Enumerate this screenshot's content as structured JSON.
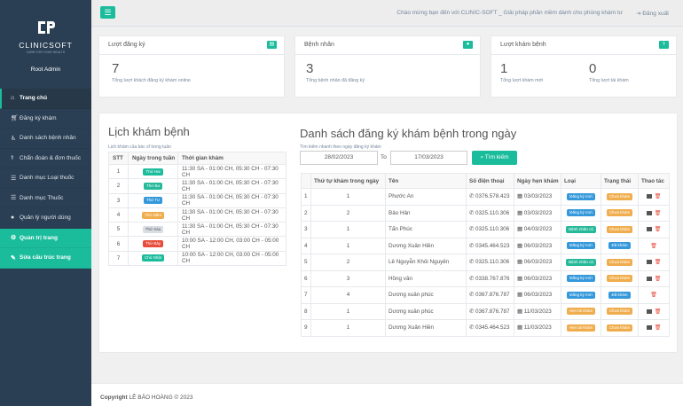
{
  "sidebar": {
    "logo_text": "CLINICSOFT",
    "logo_tagline": "CARE FOR YOUR HEALTH",
    "user": "Root Admin",
    "items": [
      {
        "label": "Trang chủ",
        "icon": "home-icon"
      },
      {
        "label": "Đăng ký khám",
        "icon": "cart-icon"
      },
      {
        "label": "Danh sách bệnh nhân",
        "icon": "wheelchair-icon"
      },
      {
        "label": "Chẩn đoán & đơn thuốc",
        "icon": "stethoscope-icon"
      },
      {
        "label": "Danh mục Loại thuốc",
        "icon": "list-icon"
      },
      {
        "label": "Danh mục Thuốc",
        "icon": "list-icon"
      },
      {
        "label": "Quản lý người dùng",
        "icon": "user-icon"
      },
      {
        "label": "Quản trị trang",
        "icon": "gear-icon"
      },
      {
        "label": "Sửa cấu trúc trang",
        "icon": "pencil-icon"
      }
    ]
  },
  "topbar": {
    "welcome": "Chào mừng bạn đến với CLINIC-SOFT _ Giải pháp phần mềm dành cho phòng khám tư",
    "logout": "Đăng xuất"
  },
  "stats": {
    "registrations": {
      "title": "Lượt đăng ký",
      "value": "7",
      "caption": "Tổng lượt khách đăng ký khám online"
    },
    "patients": {
      "title": "Bệnh nhân",
      "value": "3",
      "caption": "Tổng bệnh nhân đã đăng ký"
    },
    "visits": {
      "title": "Lượt khám bệnh",
      "new_value": "1",
      "new_caption": "Tổng lượt khám mới",
      "re_value": "0",
      "re_caption": "Tổng lượt tái khám"
    }
  },
  "schedule": {
    "title": "Lịch khám bệnh",
    "subtitle": "Lịch khám của bác sĩ trong tuần",
    "headers": [
      "STT",
      "Ngày trong tuần",
      "Thời gian khám"
    ],
    "rows": [
      {
        "stt": "1",
        "day": "Thứ Hai",
        "color": "#1abc9c",
        "time": "11:30 SA - 01:00 CH, 05:30 CH - 07:30 CH"
      },
      {
        "stt": "2",
        "day": "Thứ Ba",
        "color": "#26b99a",
        "time": "11:30 SA - 01:00 CH, 05:30 CH - 07:30 CH"
      },
      {
        "stt": "3",
        "day": "Thứ Tư",
        "color": "#3498db",
        "time": "11:30 SA - 01:00 CH, 05:30 CH - 07:30 CH"
      },
      {
        "stt": "4",
        "day": "Thứ Năm",
        "color": "#f0ad4e",
        "time": "11:30 SA - 01:00 CH, 05:30 CH - 07:30 CH"
      },
      {
        "stt": "5",
        "day": "Thứ Sáu",
        "color": "#d9dee4",
        "time": "11:30 SA - 01:00 CH, 05:30 CH - 07:30 CH"
      },
      {
        "stt": "6",
        "day": "Thứ Bảy",
        "color": "#e74c3c",
        "time": "10:00 SA - 12:00 CH, 03:00 CH - 05:00 CH"
      },
      {
        "stt": "7",
        "day": "Chủ Nhật",
        "color": "#1abc9c",
        "time": "10:00 SA - 12:00 CH, 03:00 CH - 05:00 CH"
      }
    ]
  },
  "registrations": {
    "title": "Danh sách đăng ký khám bệnh trong ngày",
    "search_label": "Tìm kiếm nhanh theo ngày đăng ký khám",
    "date_from": "28/02/2023",
    "to_label": "To",
    "date_to": "17/03/2023",
    "search_button": "Tìm kiếm",
    "headers": [
      "",
      "Thứ tự khám trong ngày",
      "Tên",
      "Số điện thoại",
      "Ngày hẹn khám",
      "Loại",
      "Trạng thái",
      "Thao tác"
    ],
    "rows": [
      {
        "idx": "1",
        "order": "1",
        "name": "Phước An",
        "phone": "0376.578.423",
        "date": "03/03/2023",
        "type": "Đăng ký mới",
        "type_color": "#3498db",
        "status": "Chưa khám",
        "status_color": "#f0ad4e",
        "view": true
      },
      {
        "idx": "2",
        "order": "2",
        "name": "Bảo Hân",
        "phone": "0325.110.306",
        "date": "03/03/2023",
        "type": "Đăng ký mới",
        "type_color": "#3498db",
        "status": "Chưa khám",
        "status_color": "#f0ad4e",
        "view": true
      },
      {
        "idx": "3",
        "order": "1",
        "name": "Tấn Phúc",
        "phone": "0325.110.306",
        "date": "04/03/2023",
        "type": "Bệnh nhân cũ",
        "type_color": "#26b99a",
        "status": "Chưa khám",
        "status_color": "#f0ad4e",
        "view": true
      },
      {
        "idx": "4",
        "order": "1",
        "name": "Dương Xuân Hiền",
        "phone": "0345.464.523",
        "date": "06/03/2023",
        "type": "Đăng ký mới",
        "type_color": "#3498db",
        "status": "Đã khám",
        "status_color": "#3498db",
        "view": false
      },
      {
        "idx": "5",
        "order": "2",
        "name": "Lê Nguyễn Khôi Nguyên",
        "phone": "0325.110.306",
        "date": "06/03/2023",
        "type": "Bệnh nhân cũ",
        "type_color": "#26b99a",
        "status": "Chưa khám",
        "status_color": "#f0ad4e",
        "view": true
      },
      {
        "idx": "6",
        "order": "3",
        "name": "Hồng vân",
        "phone": "0338.767.876",
        "date": "06/03/2023",
        "type": "Đăng ký mới",
        "type_color": "#3498db",
        "status": "Chưa khám",
        "status_color": "#f0ad4e",
        "view": true
      },
      {
        "idx": "7",
        "order": "4",
        "name": "Dương xuân phúc",
        "phone": "0367.876.787",
        "date": "06/03/2023",
        "type": "Đăng ký mới",
        "type_color": "#3498db",
        "status": "Đã khám",
        "status_color": "#3498db",
        "view": false
      },
      {
        "idx": "8",
        "order": "1",
        "name": "Dương xuân phúc",
        "phone": "0367.876.787",
        "date": "11/03/2023",
        "type": "Hẹn tái khám",
        "type_color": "#f0ad4e",
        "status": "Chưa khám",
        "status_color": "#f0ad4e",
        "view": true
      },
      {
        "idx": "9",
        "order": "1",
        "name": "Dương Xuân Hiền",
        "phone": "0345.464.523",
        "date": "11/03/2023",
        "type": "Hẹn tái khám",
        "type_color": "#f0ad4e",
        "status": "Chưa khám",
        "status_color": "#f0ad4e",
        "view": true
      }
    ]
  },
  "footer": {
    "copyright": "Copyright",
    "author": "LÊ BẢO HOÀNG © 2023"
  }
}
